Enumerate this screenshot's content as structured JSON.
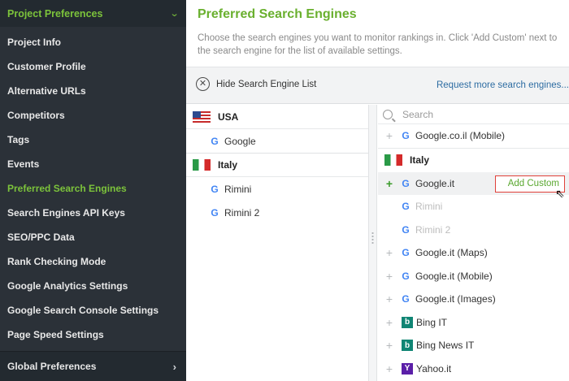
{
  "sidebar": {
    "header": "Project Preferences",
    "items": [
      "Project Info",
      "Customer Profile",
      "Alternative URLs",
      "Competitors",
      "Tags",
      "Events",
      "Preferred Search Engines",
      "Search Engines API Keys",
      "SEO/PPC Data",
      "Rank Checking Mode",
      "Google Analytics Settings",
      "Google Search Console Settings",
      "Page Speed Settings"
    ],
    "active_index": 6,
    "footer": "Global Preferences"
  },
  "main": {
    "title": "Preferred Search Engines",
    "description": "Choose the search engines you want to monitor rankings in. Click 'Add Custom' next to the search engine for the list of available settings.",
    "toolbar": {
      "hide_label": "Hide Search Engine List",
      "request_link": "Request more search engines..."
    },
    "selected": {
      "groups": [
        {
          "country": "USA",
          "engines": [
            "Google"
          ]
        },
        {
          "country": "Italy",
          "engines": [
            "Rimini",
            "Rimini 2"
          ]
        }
      ]
    },
    "available": {
      "search_placeholder": "Search",
      "top_item": "Google.co.il (Mobile)",
      "group_country": "Italy",
      "items": [
        {
          "label": "Google.it",
          "icon": "google"
        },
        {
          "label": "Rimini",
          "icon": "google"
        },
        {
          "label": "Rimini 2",
          "icon": "google"
        },
        {
          "label": "Google.it (Maps)",
          "icon": "google"
        },
        {
          "label": "Google.it (Mobile)",
          "icon": "google"
        },
        {
          "label": "Google.it (Images)",
          "icon": "google"
        },
        {
          "label": "Bing IT",
          "icon": "bing"
        },
        {
          "label": "Bing News IT",
          "icon": "bing"
        },
        {
          "label": "Yahoo.it",
          "icon": "yahoo"
        }
      ],
      "add_custom_label": "Add Custom"
    }
  },
  "colors": {
    "accent_green": "#6ab02f",
    "sidebar_bg": "#2b3138",
    "link_blue": "#2d6ca2",
    "highlight_red": "#e0413a"
  }
}
